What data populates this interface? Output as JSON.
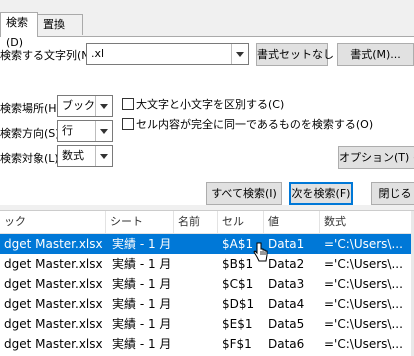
{
  "tabs": [
    {
      "label": "検索(D)"
    },
    {
      "label": "置換(P)"
    }
  ],
  "find": {
    "search_label": "検索する文字列(N):",
    "search_value": ".xl",
    "no_format_label": "書式セットなし",
    "format_button": "書式(M)..."
  },
  "options": {
    "within_label": "検索場所(H):",
    "within_value": "ブック",
    "search_dir_label": "検索方向(S):",
    "search_dir_value": "行",
    "look_in_label": "検索対象(L):",
    "look_in_value": "数式",
    "match_case_label": "大文字と小文字を区別する(C)",
    "match_entire_label": "セル内容が完全に同一であるものを検索する(O)",
    "options_button": "オプション(T) <<"
  },
  "actions": {
    "find_all": "すべて検索(I)",
    "find_next": "次を検索(F)",
    "close": "閉じる"
  },
  "results": {
    "columns": [
      "ック",
      "シート",
      "名前",
      "セル",
      "値",
      "数式"
    ],
    "rows": [
      {
        "book": "dget Master.xlsx",
        "sheet": "実績 - 1 月",
        "name": "",
        "cell": "$A$1",
        "value": "Data1",
        "formula": "='C:\\Users\\..."
      },
      {
        "book": "dget Master.xlsx",
        "sheet": "実績 - 1 月",
        "name": "",
        "cell": "$B$1",
        "value": "Data2",
        "formula": "='C:\\Users\\..."
      },
      {
        "book": "dget Master.xlsx",
        "sheet": "実績 - 1 月",
        "name": "",
        "cell": "$C$1",
        "value": "Data3",
        "formula": "='C:\\Users\\..."
      },
      {
        "book": "dget Master.xlsx",
        "sheet": "実績 - 1 月",
        "name": "",
        "cell": "$D$1",
        "value": "Data4",
        "formula": "='C:\\Users\\..."
      },
      {
        "book": "dget Master.xlsx",
        "sheet": "実績 - 1 月",
        "name": "",
        "cell": "$E$1",
        "value": "Data5",
        "formula": "='C:\\Users\\..."
      },
      {
        "book": "dget Master.xlsx",
        "sheet": "実績 - 1 月",
        "name": "",
        "cell": "$F$1",
        "value": "Data6",
        "formula": "='C:\\Users\\..."
      }
    ],
    "selected_index": 0
  },
  "colors": {
    "selection": "#0078d7",
    "accent_border": "#0078d7"
  }
}
